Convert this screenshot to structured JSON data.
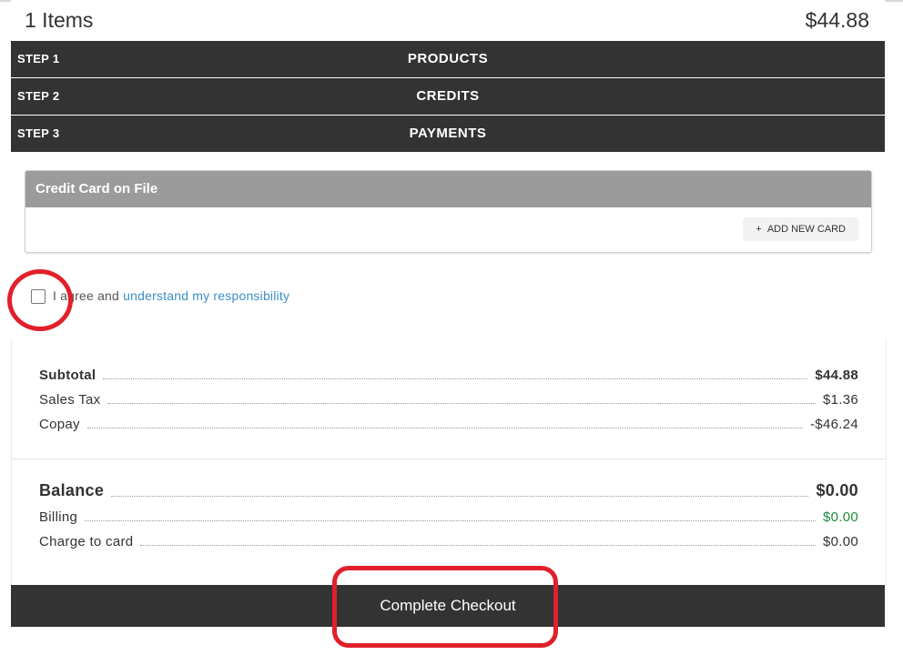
{
  "cart": {
    "items_label": "1 Items",
    "total": "$44.88"
  },
  "steps": [
    {
      "num": "STEP 1",
      "title": "PRODUCTS"
    },
    {
      "num": "STEP 2",
      "title": "CREDITS"
    },
    {
      "num": "STEP 3",
      "title": "PAYMENTS"
    }
  ],
  "card_on_file": {
    "header": "Credit Card on File",
    "add_button": {
      "icon": "+",
      "label": "ADD NEW CARD"
    }
  },
  "agreement": {
    "checked": false,
    "prefix": "I agree and ",
    "link": "understand my responsibility"
  },
  "summary": {
    "subtotal": {
      "label": "Subtotal",
      "value": "$44.88"
    },
    "sales_tax": {
      "label": "Sales Tax",
      "value": "$1.36"
    },
    "copay": {
      "label": "Copay",
      "value": "-$46.24"
    },
    "balance": {
      "label": "Balance",
      "value": "$0.00"
    },
    "billing": {
      "label": "Billing",
      "value": "$0.00"
    },
    "charge_to_card": {
      "label": "Charge to card",
      "value": "$0.00"
    }
  },
  "checkout_button": "Complete Checkout",
  "colors": {
    "dark_bar": "#333333",
    "panel_header": "#9b9b9b",
    "link": "#3b8fc4",
    "positive": "#1e8a3c",
    "annotation": "#e0202a"
  }
}
